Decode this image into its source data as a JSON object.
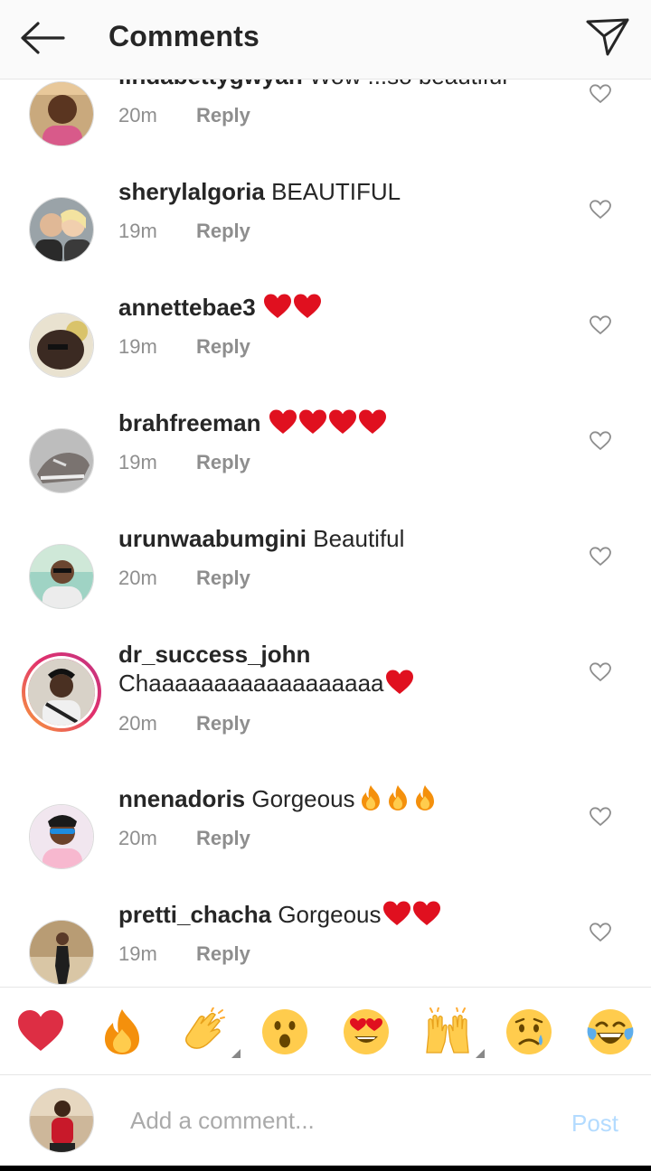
{
  "header": {
    "title": "Comments"
  },
  "comments": [
    {
      "username": "lindabettygwyan",
      "text": "Wow ...so beautiful",
      "time": "20m",
      "reply": "Reply",
      "hearts": 0,
      "fires": 0
    },
    {
      "username": "sherylalgoria",
      "text": "BEAUTIFUL",
      "time": "19m",
      "reply": "Reply",
      "hearts": 0,
      "fires": 0
    },
    {
      "username": "annettebae3",
      "text": "",
      "time": "19m",
      "reply": "Reply",
      "hearts": 2,
      "fires": 0
    },
    {
      "username": "brahfreeman",
      "text": "",
      "time": "19m",
      "reply": "Reply",
      "hearts": 4,
      "fires": 0
    },
    {
      "username": "urunwaabumgini",
      "text": "Beautiful",
      "time": "20m",
      "reply": "Reply",
      "hearts": 0,
      "fires": 0
    },
    {
      "username": "dr_success_john",
      "text": "Chaaaaaaaaaaaaaaaaaa",
      "time": "20m",
      "reply": "Reply",
      "hearts": 1,
      "fires": 0
    },
    {
      "username": "nnenadoris",
      "text": "Gorgeous",
      "time": "20m",
      "reply": "Reply",
      "hearts": 0,
      "fires": 3
    },
    {
      "username": "pretti_chacha",
      "text": "Gorgeous",
      "time": "19m",
      "reply": "Reply",
      "hearts": 2,
      "fires": 0
    }
  ],
  "emoji_bar": [
    "red-heart",
    "fire",
    "clapping-hands",
    "surprised-face",
    "heart-eyes-face",
    "raising-hands",
    "sad-tear-face",
    "tears-of-joy-face"
  ],
  "composer": {
    "placeholder": "Add a comment...",
    "post_label": "Post"
  },
  "colors": {
    "heart": "#e0101f",
    "post_disabled": "#b3dbff",
    "muted": "#8e8e8e"
  }
}
